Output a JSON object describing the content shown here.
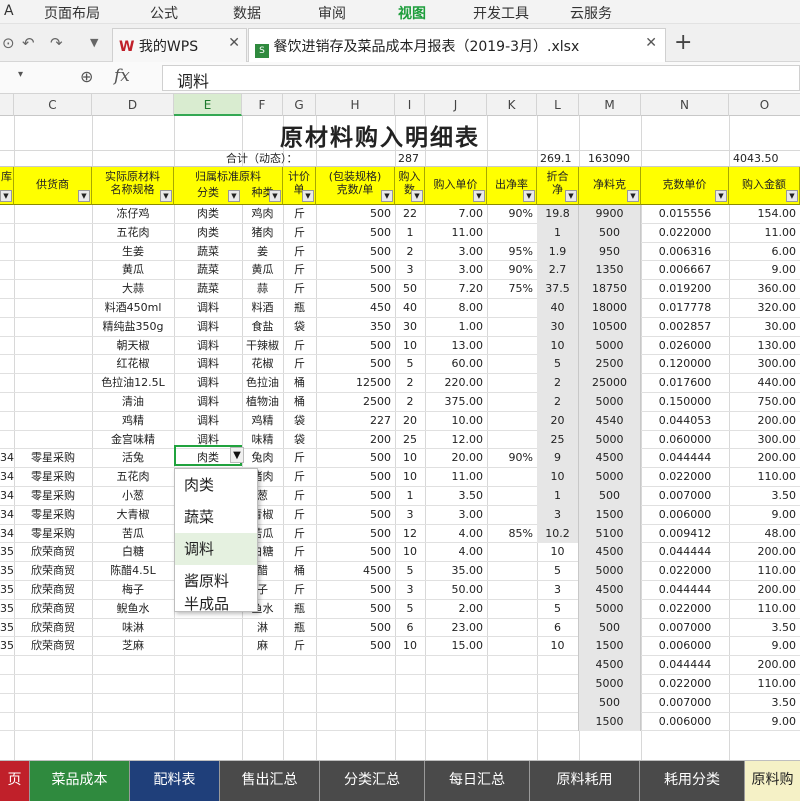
{
  "menu": [
    "A",
    "页面布局",
    "公式",
    "数据",
    "审阅",
    "视图",
    "开发工具",
    "云服务"
  ],
  "menu_active": "视图",
  "tabs": [
    {
      "label": "我的WPS",
      "active": false
    },
    {
      "label": "餐饮进销存及菜品成本月报表（2019-3月）.xlsx",
      "active": true
    }
  ],
  "formula": {
    "fx": "fx",
    "content": "调料"
  },
  "columns": [
    "C",
    "D",
    "E",
    "F",
    "G",
    "H",
    "I",
    "J",
    "K",
    "L",
    "M",
    "N",
    "O"
  ],
  "selected_column": "E",
  "sheet": {
    "title": "原材料购入明细表",
    "summary": {
      "label": "合计（动态）：",
      "qty": "287",
      "l": "269.1",
      "m": "163090",
      "o": "4043.50"
    },
    "headers": {
      "b": "库",
      "c": "供货商",
      "d": [
        "实际原材料",
        "名称规格"
      ],
      "e": [
        "归属标准原料",
        "分类"
      ],
      "f": "种类",
      "g": [
        "计价",
        "单"
      ],
      "h": [
        "(包装规格)",
        "克数/单"
      ],
      "i": [
        "购入",
        "数"
      ],
      "j": "购入单价",
      "k": "出净率",
      "l": [
        "折合",
        "净"
      ],
      "m": "净料克",
      "n": "克数单价",
      "o": "购入金额"
    },
    "rows": [
      {
        "b": "",
        "c": "",
        "d": "冻仔鸡",
        "e": "肉类",
        "f": "鸡肉",
        "g": "斤",
        "h": "500",
        "i": "22",
        "j": "7.00",
        "k": "90%",
        "l": "19.8",
        "m": "9900",
        "n": "0.015556",
        "o": "154.00"
      },
      {
        "b": "",
        "c": "",
        "d": "五花肉",
        "e": "肉类",
        "f": "猪肉",
        "g": "斤",
        "h": "500",
        "i": "1",
        "j": "11.00",
        "k": "",
        "l": "1",
        "m": "500",
        "n": "0.022000",
        "o": "11.00"
      },
      {
        "b": "",
        "c": "",
        "d": "生姜",
        "e": "蔬菜",
        "f": "姜",
        "g": "斤",
        "h": "500",
        "i": "2",
        "j": "3.00",
        "k": "95%",
        "l": "1.9",
        "m": "950",
        "n": "0.006316",
        "o": "6.00"
      },
      {
        "b": "",
        "c": "",
        "d": "黄瓜",
        "e": "蔬菜",
        "f": "黄瓜",
        "g": "斤",
        "h": "500",
        "i": "3",
        "j": "3.00",
        "k": "90%",
        "l": "2.7",
        "m": "1350",
        "n": "0.006667",
        "o": "9.00"
      },
      {
        "b": "",
        "c": "",
        "d": "大蒜",
        "e": "蔬菜",
        "f": "蒜",
        "g": "斤",
        "h": "500",
        "i": "50",
        "j": "7.20",
        "k": "75%",
        "l": "37.5",
        "m": "18750",
        "n": "0.019200",
        "o": "360.00"
      },
      {
        "b": "",
        "c": "",
        "d": "料酒450ml",
        "e": "调料",
        "f": "料酒",
        "g": "瓶",
        "h": "450",
        "i": "40",
        "j": "8.00",
        "k": "",
        "l": "40",
        "m": "18000",
        "n": "0.017778",
        "o": "320.00"
      },
      {
        "b": "",
        "c": "",
        "d": "精纯盐350g",
        "e": "调料",
        "f": "食盐",
        "g": "袋",
        "h": "350",
        "i": "30",
        "j": "1.00",
        "k": "",
        "l": "30",
        "m": "10500",
        "n": "0.002857",
        "o": "30.00"
      },
      {
        "b": "",
        "c": "",
        "d": "朝天椒",
        "e": "调料",
        "f": "干辣椒",
        "g": "斤",
        "h": "500",
        "i": "10",
        "j": "13.00",
        "k": "",
        "l": "10",
        "m": "5000",
        "n": "0.026000",
        "o": "130.00"
      },
      {
        "b": "",
        "c": "",
        "d": "红花椒",
        "e": "调料",
        "f": "花椒",
        "g": "斤",
        "h": "500",
        "i": "5",
        "j": "60.00",
        "k": "",
        "l": "5",
        "m": "2500",
        "n": "0.120000",
        "o": "300.00"
      },
      {
        "b": "",
        "c": "",
        "d": "色拉油12.5L",
        "e": "调料",
        "f": "色拉油",
        "g": "桶",
        "h": "12500",
        "i": "2",
        "j": "220.00",
        "k": "",
        "l": "2",
        "m": "25000",
        "n": "0.017600",
        "o": "440.00"
      },
      {
        "b": "",
        "c": "",
        "d": "清油",
        "e": "调料",
        "f": "植物油",
        "g": "桶",
        "h": "2500",
        "i": "2",
        "j": "375.00",
        "k": "",
        "l": "2",
        "m": "5000",
        "n": "0.150000",
        "o": "750.00"
      },
      {
        "b": "",
        "c": "",
        "d": "鸡精",
        "e": "调料",
        "f": "鸡精",
        "g": "袋",
        "h": "227",
        "i": "20",
        "j": "10.00",
        "k": "",
        "l": "20",
        "m": "4540",
        "n": "0.044053",
        "o": "200.00"
      },
      {
        "b": "",
        "c": "",
        "d": "金宫味精",
        "e": "调料",
        "f": "味精",
        "g": "袋",
        "h": "200",
        "i": "25",
        "j": "12.00",
        "k": "",
        "l": "25",
        "m": "5000",
        "n": "0.060000",
        "o": "300.00"
      },
      {
        "b": "34",
        "c": "零星采购",
        "d": "活兔",
        "e": "肉类",
        "f": "兔肉",
        "g": "斤",
        "h": "500",
        "i": "10",
        "j": "20.00",
        "k": "90%",
        "l": "9",
        "m": "4500",
        "n": "0.044444",
        "o": "200.00"
      },
      {
        "b": "34",
        "c": "零星采购",
        "d": "五花肉",
        "e": "肉类",
        "f": "猪肉",
        "g": "斤",
        "h": "500",
        "i": "10",
        "j": "11.00",
        "k": "",
        "l": "10",
        "m": "5000",
        "n": "0.022000",
        "o": "110.00"
      },
      {
        "b": "34",
        "c": "零星采购",
        "d": "小葱",
        "e": "蔬菜",
        "f": "葱",
        "g": "斤",
        "h": "500",
        "i": "1",
        "j": "3.50",
        "k": "",
        "l": "1",
        "m": "500",
        "n": "0.007000",
        "o": "3.50"
      },
      {
        "b": "34",
        "c": "零星采购",
        "d": "大青椒",
        "e": "蔬菜",
        "f": "青椒",
        "g": "斤",
        "h": "500",
        "i": "3",
        "j": "3.00",
        "k": "",
        "l": "3",
        "m": "1500",
        "n": "0.006000",
        "o": "9.00"
      },
      {
        "b": "34",
        "c": "零星采购",
        "d": "苦瓜",
        "e": "蔬菜",
        "f": "苦瓜",
        "g": "斤",
        "h": "500",
        "i": "12",
        "j": "4.00",
        "k": "85%",
        "l": "10.2",
        "m": "5100",
        "n": "0.009412",
        "o": "48.00"
      },
      {
        "b": "35",
        "c": "欣荣商贸",
        "d": "白糖",
        "e": "调料",
        "f": "白糖",
        "g": "斤",
        "h": "500",
        "i": "10",
        "j": "4.00",
        "k": "",
        "l": "10",
        "m": "4500",
        "n": "0.044444",
        "o": "200.00"
      },
      {
        "b": "35",
        "c": "欣荣商贸",
        "d": "陈醋4.5L",
        "e": "调料",
        "f": "醋",
        "g": "桶",
        "h": "4500",
        "i": "5",
        "j": "35.00",
        "k": "",
        "l": "5",
        "m": "5000",
        "n": "0.022000",
        "o": "110.00"
      },
      {
        "b": "35",
        "c": "欣荣商贸",
        "d": "梅子",
        "e": "",
        "f": "子",
        "g": "斤",
        "h": "500",
        "i": "3",
        "j": "50.00",
        "k": "",
        "l": "3",
        "m": "4500",
        "n": "0.044444",
        "o": "200.00"
      },
      {
        "b": "35",
        "c": "欣荣商贸",
        "d": "鲵鱼水",
        "e": "",
        "f": "鱼水",
        "g": "瓶",
        "h": "500",
        "i": "5",
        "j": "2.00",
        "k": "",
        "l": "5",
        "m": "5000",
        "n": "0.022000",
        "o": "110.00"
      },
      {
        "b": "35",
        "c": "欣荣商贸",
        "d": "味淋",
        "e": "",
        "f": "淋",
        "g": "瓶",
        "h": "500",
        "i": "6",
        "j": "23.00",
        "k": "",
        "l": "6",
        "m": "500",
        "n": "0.007000",
        "o": "3.50"
      },
      {
        "b": "35",
        "c": "欣荣商贸",
        "d": "芝麻",
        "e": "",
        "f": "麻",
        "g": "斤",
        "h": "500",
        "i": "10",
        "j": "15.00",
        "k": "",
        "l": "10",
        "m": "1500",
        "n": "0.006000",
        "o": "9.00"
      },
      {
        "b": "",
        "c": "",
        "d": "",
        "e": "",
        "f": "",
        "g": "",
        "h": "",
        "i": "",
        "j": "",
        "k": "",
        "l": "",
        "m": "4500",
        "n": "0.044444",
        "o": "200.00"
      },
      {
        "b": "",
        "c": "",
        "d": "",
        "e": "",
        "f": "",
        "g": "",
        "h": "",
        "i": "",
        "j": "",
        "k": "",
        "l": "",
        "m": "5000",
        "n": "0.022000",
        "o": "110.00"
      },
      {
        "b": "",
        "c": "",
        "d": "",
        "e": "",
        "f": "",
        "g": "",
        "h": "",
        "i": "",
        "j": "",
        "k": "",
        "l": "",
        "m": "500",
        "n": "0.007000",
        "o": "3.50"
      },
      {
        "b": "",
        "c": "",
        "d": "",
        "e": "",
        "f": "",
        "g": "",
        "h": "",
        "i": "",
        "j": "",
        "k": "",
        "l": "",
        "m": "1500",
        "n": "0.006000",
        "o": "9.00"
      }
    ]
  },
  "dropdown": {
    "options": [
      "肉类",
      "蔬菜",
      "调料",
      "酱原料",
      "半成品"
    ],
    "selected": "调料"
  },
  "sheet_tabs": [
    {
      "label": "页",
      "color": "#c0202a",
      "text": "#ffffff"
    },
    {
      "label": "菜品成本",
      "color": "#2f8a3e",
      "text": "#ffffff"
    },
    {
      "label": "配料表",
      "color": "#1f3f7a",
      "text": "#ffffff"
    },
    {
      "label": "售出汇总",
      "color": "#4a4a4a",
      "text": "#ffffff"
    },
    {
      "label": "分类汇总",
      "color": "#4a4a4a",
      "text": "#ffffff"
    },
    {
      "label": "每日汇总",
      "color": "#4a4a4a",
      "text": "#ffffff"
    },
    {
      "label": "原料耗用",
      "color": "#4a4a4a",
      "text": "#ffffff"
    },
    {
      "label": "耗用分类",
      "color": "#4a4a4a",
      "text": "#ffffff"
    },
    {
      "label": "原料购",
      "color": "#f5f1c6",
      "text": "#222222"
    }
  ],
  "colors": {
    "header_yellow": "#ffff00",
    "accent_green": "#20a33e",
    "grid": "#d8d8d8"
  }
}
